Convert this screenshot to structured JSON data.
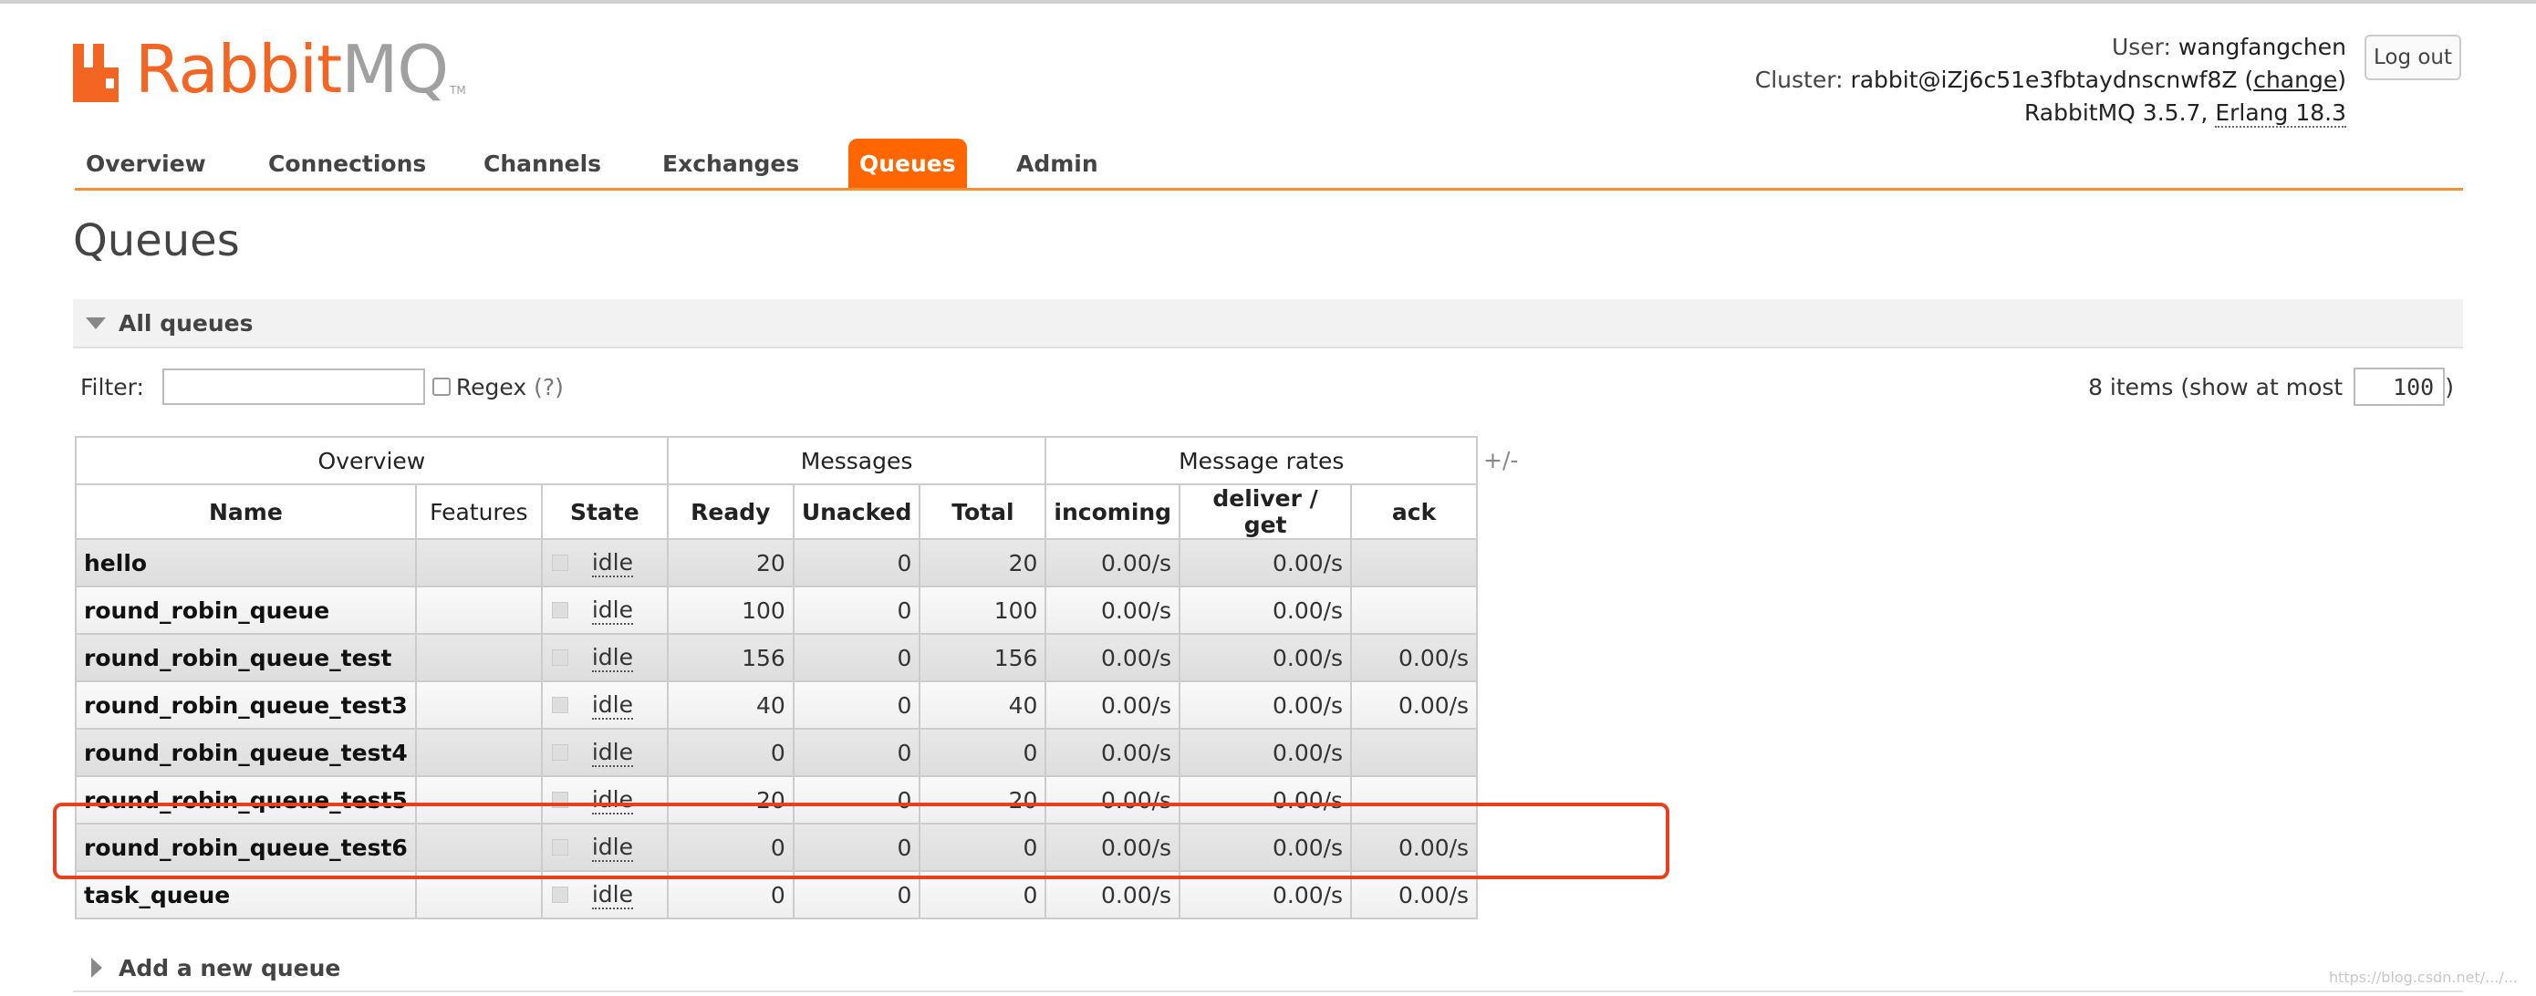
{
  "logo": {
    "brand": "Rabbit",
    "suffix": "MQ",
    "tm": "TM"
  },
  "header": {
    "user_label": "User:",
    "user": "wangfangchen",
    "cluster_label": "Cluster:",
    "cluster": "rabbit@iZj6c51e3fbtaydnscnwf8Z",
    "change_link": "change",
    "version": "RabbitMQ 3.5.7,",
    "erlang": "Erlang 18.3",
    "logout_label": "Log out"
  },
  "nav": {
    "tabs": [
      {
        "label": "Overview"
      },
      {
        "label": "Connections"
      },
      {
        "label": "Channels"
      },
      {
        "label": "Exchanges"
      },
      {
        "label": "Queues",
        "active": true
      },
      {
        "label": "Admin"
      }
    ]
  },
  "page": {
    "title": "Queues",
    "section_title": "All queues",
    "filter_label": "Filter:",
    "filter_value": "",
    "regex_label": "Regex",
    "regex_help": "(?)",
    "items_text": "8 items (show at most",
    "items_max": "100",
    "items_close": ")",
    "add_queue_label": "Add a new queue",
    "watermark": "https://blog.csdn.net/.../..."
  },
  "table": {
    "groups": [
      "Overview",
      "Messages",
      "Message rates"
    ],
    "toggle_columns": "+/-",
    "columns": [
      "Name",
      "Features",
      "State",
      "Ready",
      "Unacked",
      "Total",
      "incoming",
      "deliver / get",
      "ack"
    ],
    "rows": [
      {
        "name": "hello",
        "features": "",
        "state": "idle",
        "ready": "20",
        "unacked": "0",
        "total": "20",
        "incoming": "0.00/s",
        "deliver": "0.00/s",
        "ack": ""
      },
      {
        "name": "round_robin_queue",
        "features": "",
        "state": "idle",
        "ready": "100",
        "unacked": "0",
        "total": "100",
        "incoming": "0.00/s",
        "deliver": "0.00/s",
        "ack": ""
      },
      {
        "name": "round_robin_queue_test",
        "features": "",
        "state": "idle",
        "ready": "156",
        "unacked": "0",
        "total": "156",
        "incoming": "0.00/s",
        "deliver": "0.00/s",
        "ack": "0.00/s"
      },
      {
        "name": "round_robin_queue_test3",
        "features": "",
        "state": "idle",
        "ready": "40",
        "unacked": "0",
        "total": "40",
        "incoming": "0.00/s",
        "deliver": "0.00/s",
        "ack": "0.00/s"
      },
      {
        "name": "round_robin_queue_test4",
        "features": "",
        "state": "idle",
        "ready": "0",
        "unacked": "0",
        "total": "0",
        "incoming": "0.00/s",
        "deliver": "0.00/s",
        "ack": ""
      },
      {
        "name": "round_robin_queue_test5",
        "features": "",
        "state": "idle",
        "ready": "20",
        "unacked": "0",
        "total": "20",
        "incoming": "0.00/s",
        "deliver": "0.00/s",
        "ack": ""
      },
      {
        "name": "round_robin_queue_test6",
        "features": "",
        "state": "idle",
        "ready": "0",
        "unacked": "0",
        "total": "0",
        "incoming": "0.00/s",
        "deliver": "0.00/s",
        "ack": "0.00/s"
      },
      {
        "name": "task_queue",
        "features": "",
        "state": "idle",
        "ready": "0",
        "unacked": "0",
        "total": "0",
        "incoming": "0.00/s",
        "deliver": "0.00/s",
        "ack": "0.00/s"
      }
    ]
  },
  "colors": {
    "accent": "#ff6600",
    "highlight": "#e8401c"
  }
}
